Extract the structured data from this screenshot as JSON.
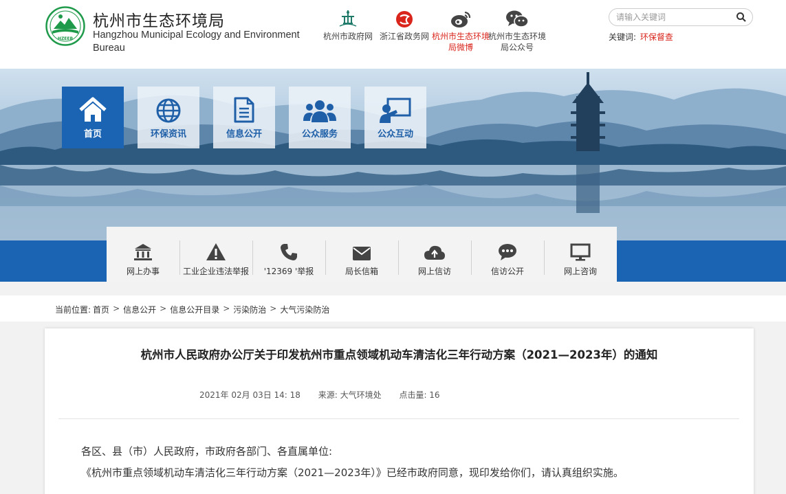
{
  "site": {
    "title": "杭州市生态环境局",
    "title_en": "Hangzhou Municipal Ecology and Environment Bureau",
    "logo_text": "HZEEB"
  },
  "quick_links": [
    {
      "label": "杭州市政府网",
      "icon": "hangzhou-gov-icon",
      "highlight": false
    },
    {
      "label": "浙江省政务网",
      "icon": "zhejiang-gov-icon",
      "highlight": false
    },
    {
      "label": "杭州市生态环境局微博",
      "icon": "weibo-icon",
      "highlight": true
    },
    {
      "label": "杭州市生态环境局公众号",
      "icon": "wechat-icon",
      "highlight": false
    }
  ],
  "search": {
    "placeholder": "请输入关键词",
    "keywords_label": "关键词:",
    "keyword": "环保督查"
  },
  "main_nav": [
    {
      "label": "首页",
      "icon": "home-icon",
      "active": true
    },
    {
      "label": "环保资讯",
      "icon": "globe-icon",
      "active": false
    },
    {
      "label": "信息公开",
      "icon": "document-icon",
      "active": false
    },
    {
      "label": "公众服务",
      "icon": "users-icon",
      "active": false
    },
    {
      "label": "公众互动",
      "icon": "presentation-icon",
      "active": false
    }
  ],
  "services": [
    {
      "label": "网上办事",
      "icon": "government-building-icon"
    },
    {
      "label": "工业企业违法举报",
      "icon": "warning-icon"
    },
    {
      "label": "'12369 '举报",
      "icon": "phone-icon"
    },
    {
      "label": "局长信箱",
      "icon": "envelope-icon"
    },
    {
      "label": "网上信访",
      "icon": "cloud-upload-icon"
    },
    {
      "label": "信访公开",
      "icon": "chat-bubble-icon"
    },
    {
      "label": "网上咨询",
      "icon": "monitor-icon"
    }
  ],
  "breadcrumb": {
    "label": "当前位置:",
    "items": [
      "首页",
      "信息公开",
      "信息公开目录",
      "污染防治",
      "大气污染防治"
    ],
    "separator": ">"
  },
  "article": {
    "title": "杭州市人民政府办公厅关于印发杭州市重点领域机动车清洁化三年行动方案（2021—2023年）的通知",
    "date": "2021年 02月 03日 14: 18",
    "source": "来源: 大气环境处",
    "views": "点击量: 16",
    "paragraphs": [
      "各区、县（市）人民政府，市政府各部门、各直属单位:",
      "《杭州市重点领域机动车清洁化三年行动方案（2021—2023年）》已经市政府同意，现印发给你们，请认真组织实施。"
    ]
  },
  "colors": {
    "primary_blue": "#1a64b3",
    "accent_red": "#d9251c",
    "logo_green": "#1f9a4a"
  }
}
